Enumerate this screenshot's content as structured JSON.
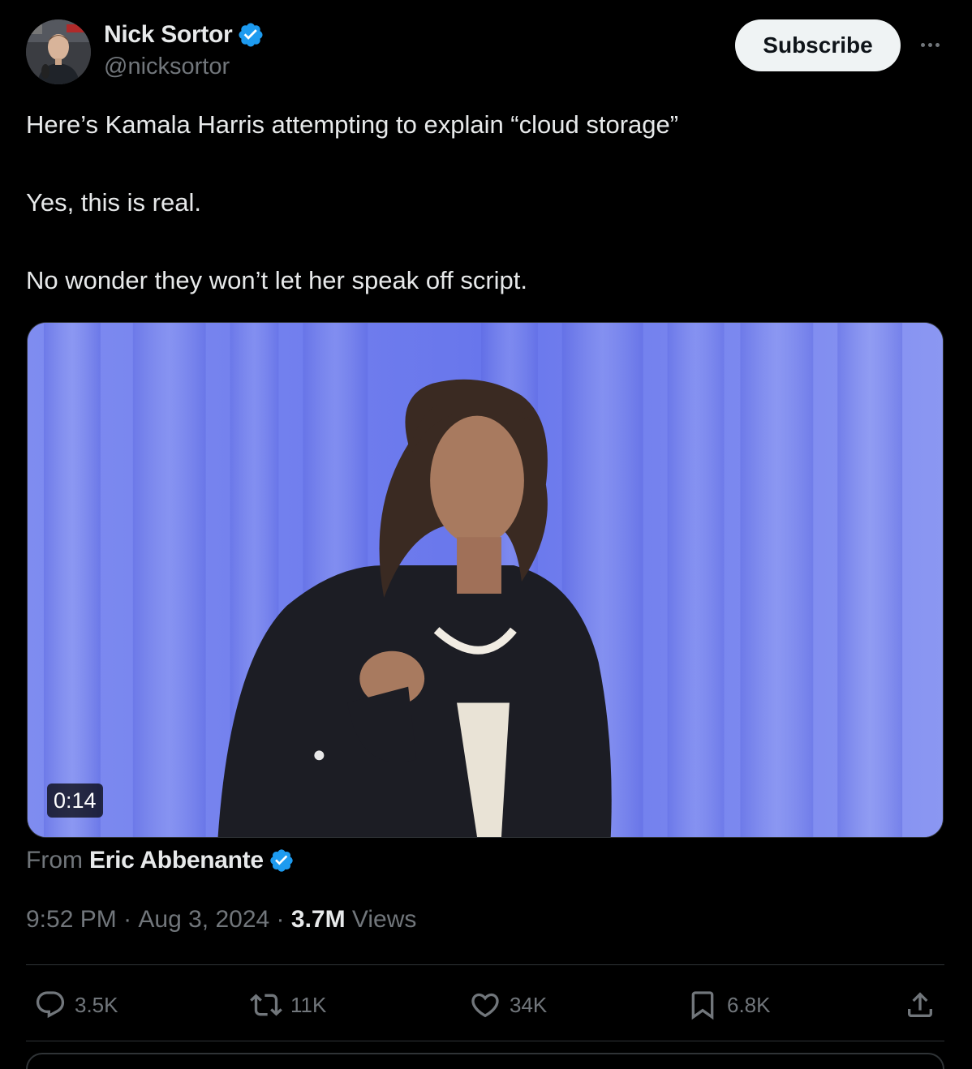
{
  "author": {
    "display_name": "Nick Sortor",
    "handle": "@nicksortor",
    "verified_icon": "verified-badge-icon"
  },
  "header": {
    "subscribe_label": "Subscribe",
    "more_icon": "more-options-icon"
  },
  "tweet": {
    "lines": [
      "Here’s Kamala Harris attempting to explain “cloud storage”",
      "Yes, this is real.",
      "No wonder they won’t let her speak off script."
    ]
  },
  "media": {
    "duration": "0:14",
    "from_prefix": "From",
    "from_name": "Eric Abbenante"
  },
  "meta": {
    "time": "9:52 PM",
    "separator": " · ",
    "date": "Aug 3, 2024",
    "views_count": "3.7M",
    "views_label": " Views"
  },
  "actions": {
    "replies": "3.5K",
    "reposts": "11K",
    "likes": "34K",
    "bookmarks": "6.8K"
  },
  "colors": {
    "background": "#000000",
    "text": "#e7e9ea",
    "muted": "#71767b",
    "verified": "#1d9bf0",
    "divider": "#2f3336"
  }
}
